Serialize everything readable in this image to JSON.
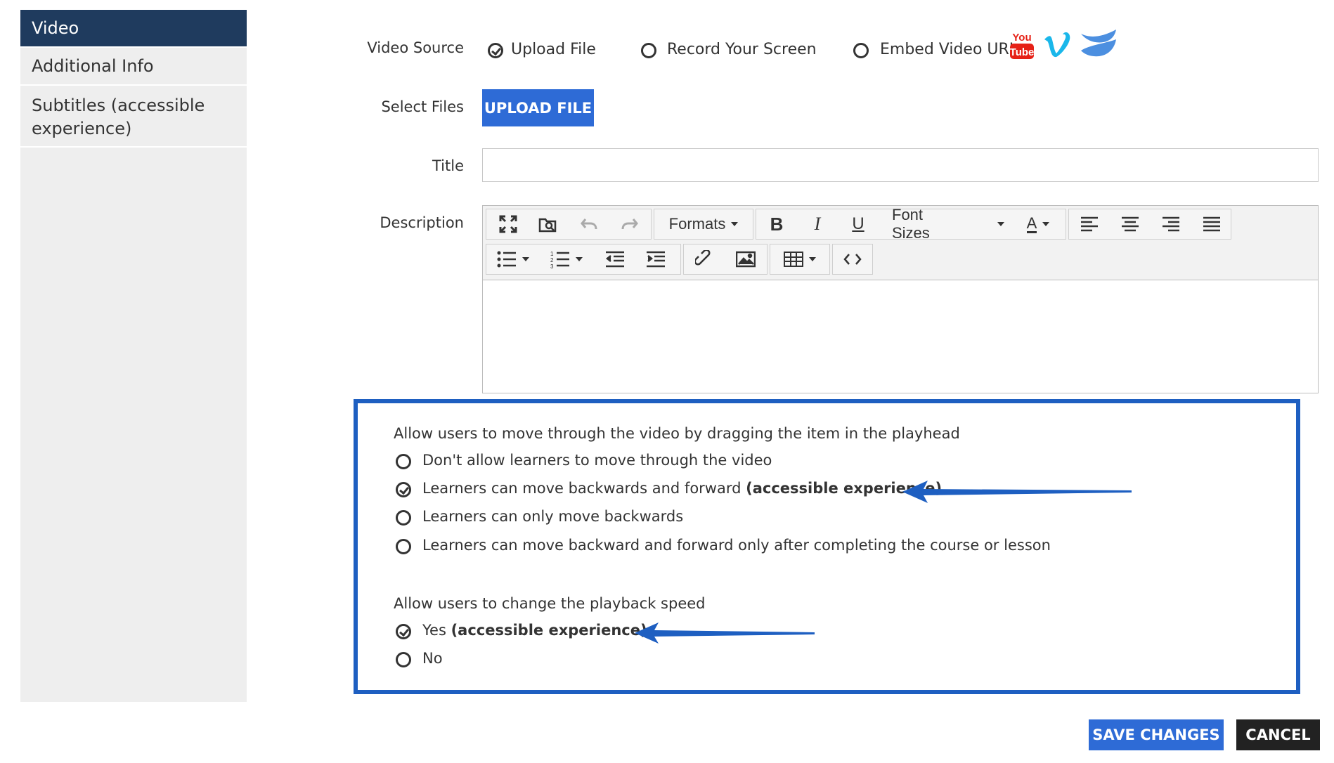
{
  "sidebar": {
    "items": [
      {
        "label": "Video",
        "active": true
      },
      {
        "label": "Additional Info"
      },
      {
        "label": "Subtitles (accessible",
        "label2": "experience)"
      }
    ]
  },
  "video_source": {
    "label": "Video Source",
    "options": [
      "Upload File",
      "Record Your Screen",
      "Embed Video URL"
    ],
    "selected": "Upload File",
    "provider_icons": [
      "youtube-icon",
      "vimeo-icon",
      "wistia-icon"
    ]
  },
  "select_files": {
    "label": "Select Files",
    "button": "UPLOAD FILE"
  },
  "title_field": {
    "label": "Title",
    "value": ""
  },
  "description": {
    "label": "Description",
    "toolbar": {
      "formats": "Formats",
      "font_sizes": "Font Sizes",
      "bold": "B",
      "italic": "I",
      "underline": "U",
      "font_color": "A"
    }
  },
  "scrub": {
    "question": "Allow users to move through the video by dragging the item in the playhead",
    "options": [
      {
        "text": "Don't allow learners to move through the video",
        "bold": ""
      },
      {
        "text": "Learners can move backwards and forward ",
        "bold": "(accessible experience)"
      },
      {
        "text": "Learners can only move backwards",
        "bold": ""
      },
      {
        "text": "Learners can move backward and forward only after completing the course or lesson",
        "bold": ""
      }
    ],
    "selected_index": 1
  },
  "speed": {
    "question": "Allow users to change the playback speed",
    "options": [
      {
        "text": "Yes ",
        "bold": "(accessible experience)"
      },
      {
        "text": "No",
        "bold": ""
      }
    ],
    "selected_index": 0
  },
  "actions": {
    "save": "SAVE CHANGES",
    "cancel": "CANCEL"
  },
  "colors": {
    "accent": "#2e6bd6",
    "sidebar_active": "#1f3b5e",
    "highlight_box": "#1e5fc1",
    "youtube": "#e62117",
    "vimeo": "#1ab7ea",
    "wistia": "#4c8fe0"
  }
}
